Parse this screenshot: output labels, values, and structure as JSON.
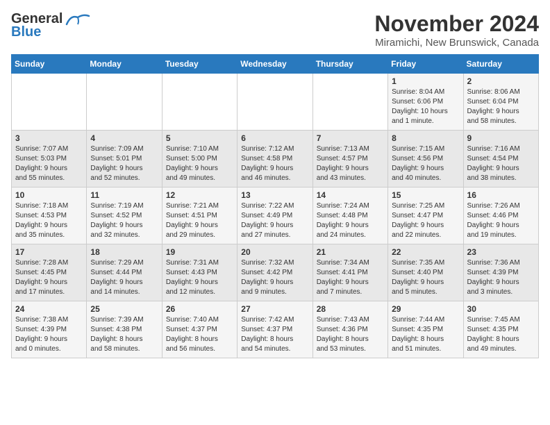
{
  "logo": {
    "line1": "General",
    "line2": "Blue"
  },
  "title": "November 2024",
  "location": "Miramichi, New Brunswick, Canada",
  "weekdays": [
    "Sunday",
    "Monday",
    "Tuesday",
    "Wednesday",
    "Thursday",
    "Friday",
    "Saturday"
  ],
  "weeks": [
    [
      {
        "day": "",
        "info": ""
      },
      {
        "day": "",
        "info": ""
      },
      {
        "day": "",
        "info": ""
      },
      {
        "day": "",
        "info": ""
      },
      {
        "day": "",
        "info": ""
      },
      {
        "day": "1",
        "info": "Sunrise: 8:04 AM\nSunset: 6:06 PM\nDaylight: 10 hours\nand 1 minute."
      },
      {
        "day": "2",
        "info": "Sunrise: 8:06 AM\nSunset: 6:04 PM\nDaylight: 9 hours\nand 58 minutes."
      }
    ],
    [
      {
        "day": "3",
        "info": "Sunrise: 7:07 AM\nSunset: 5:03 PM\nDaylight: 9 hours\nand 55 minutes."
      },
      {
        "day": "4",
        "info": "Sunrise: 7:09 AM\nSunset: 5:01 PM\nDaylight: 9 hours\nand 52 minutes."
      },
      {
        "day": "5",
        "info": "Sunrise: 7:10 AM\nSunset: 5:00 PM\nDaylight: 9 hours\nand 49 minutes."
      },
      {
        "day": "6",
        "info": "Sunrise: 7:12 AM\nSunset: 4:58 PM\nDaylight: 9 hours\nand 46 minutes."
      },
      {
        "day": "7",
        "info": "Sunrise: 7:13 AM\nSunset: 4:57 PM\nDaylight: 9 hours\nand 43 minutes."
      },
      {
        "day": "8",
        "info": "Sunrise: 7:15 AM\nSunset: 4:56 PM\nDaylight: 9 hours\nand 40 minutes."
      },
      {
        "day": "9",
        "info": "Sunrise: 7:16 AM\nSunset: 4:54 PM\nDaylight: 9 hours\nand 38 minutes."
      }
    ],
    [
      {
        "day": "10",
        "info": "Sunrise: 7:18 AM\nSunset: 4:53 PM\nDaylight: 9 hours\nand 35 minutes."
      },
      {
        "day": "11",
        "info": "Sunrise: 7:19 AM\nSunset: 4:52 PM\nDaylight: 9 hours\nand 32 minutes."
      },
      {
        "day": "12",
        "info": "Sunrise: 7:21 AM\nSunset: 4:51 PM\nDaylight: 9 hours\nand 29 minutes."
      },
      {
        "day": "13",
        "info": "Sunrise: 7:22 AM\nSunset: 4:49 PM\nDaylight: 9 hours\nand 27 minutes."
      },
      {
        "day": "14",
        "info": "Sunrise: 7:24 AM\nSunset: 4:48 PM\nDaylight: 9 hours\nand 24 minutes."
      },
      {
        "day": "15",
        "info": "Sunrise: 7:25 AM\nSunset: 4:47 PM\nDaylight: 9 hours\nand 22 minutes."
      },
      {
        "day": "16",
        "info": "Sunrise: 7:26 AM\nSunset: 4:46 PM\nDaylight: 9 hours\nand 19 minutes."
      }
    ],
    [
      {
        "day": "17",
        "info": "Sunrise: 7:28 AM\nSunset: 4:45 PM\nDaylight: 9 hours\nand 17 minutes."
      },
      {
        "day": "18",
        "info": "Sunrise: 7:29 AM\nSunset: 4:44 PM\nDaylight: 9 hours\nand 14 minutes."
      },
      {
        "day": "19",
        "info": "Sunrise: 7:31 AM\nSunset: 4:43 PM\nDaylight: 9 hours\nand 12 minutes."
      },
      {
        "day": "20",
        "info": "Sunrise: 7:32 AM\nSunset: 4:42 PM\nDaylight: 9 hours\nand 9 minutes."
      },
      {
        "day": "21",
        "info": "Sunrise: 7:34 AM\nSunset: 4:41 PM\nDaylight: 9 hours\nand 7 minutes."
      },
      {
        "day": "22",
        "info": "Sunrise: 7:35 AM\nSunset: 4:40 PM\nDaylight: 9 hours\nand 5 minutes."
      },
      {
        "day": "23",
        "info": "Sunrise: 7:36 AM\nSunset: 4:39 PM\nDaylight: 9 hours\nand 3 minutes."
      }
    ],
    [
      {
        "day": "24",
        "info": "Sunrise: 7:38 AM\nSunset: 4:39 PM\nDaylight: 9 hours\nand 0 minutes."
      },
      {
        "day": "25",
        "info": "Sunrise: 7:39 AM\nSunset: 4:38 PM\nDaylight: 8 hours\nand 58 minutes."
      },
      {
        "day": "26",
        "info": "Sunrise: 7:40 AM\nSunset: 4:37 PM\nDaylight: 8 hours\nand 56 minutes."
      },
      {
        "day": "27",
        "info": "Sunrise: 7:42 AM\nSunset: 4:37 PM\nDaylight: 8 hours\nand 54 minutes."
      },
      {
        "day": "28",
        "info": "Sunrise: 7:43 AM\nSunset: 4:36 PM\nDaylight: 8 hours\nand 53 minutes."
      },
      {
        "day": "29",
        "info": "Sunrise: 7:44 AM\nSunset: 4:35 PM\nDaylight: 8 hours\nand 51 minutes."
      },
      {
        "day": "30",
        "info": "Sunrise: 7:45 AM\nSunset: 4:35 PM\nDaylight: 8 hours\nand 49 minutes."
      }
    ]
  ]
}
